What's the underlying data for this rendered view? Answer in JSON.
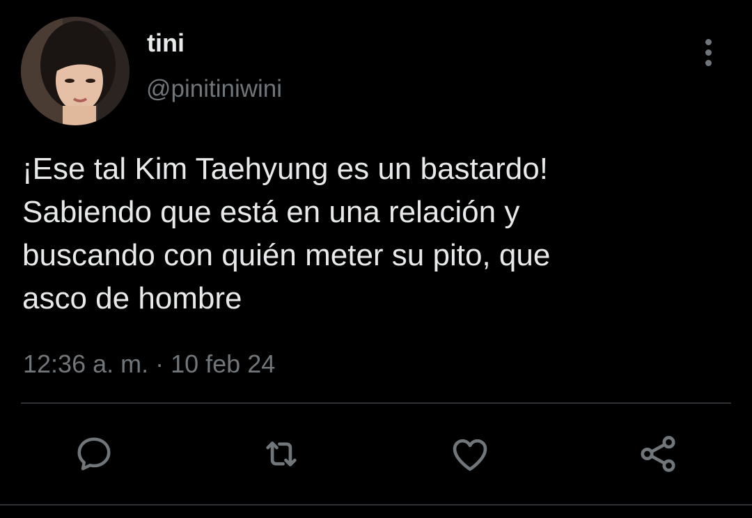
{
  "tweet": {
    "display_name": "tini",
    "handle": "@pinitiniwini",
    "text": "¡Ese tal Kim Taehyung es un bastardo!\nSabiendo que está en una relación y\nbuscando con quién meter su pito, que\nasco de hombre",
    "timestamp": "12:36 a. m. · 10 feb 24"
  },
  "actions": [
    "reply-icon",
    "retweet-icon",
    "like-icon",
    "share-icon"
  ],
  "colors": {
    "background": "#000000",
    "primary_text": "#e7e9ea",
    "secondary_text": "#71767b",
    "divider": "#2f3336"
  }
}
